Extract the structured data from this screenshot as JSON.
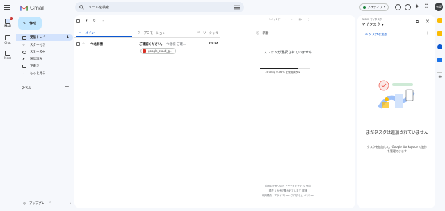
{
  "app": {
    "name": "Gmail"
  },
  "rail": {
    "mail_label": "Mail",
    "mail_badge": "1",
    "chat_label": "Chat",
    "meet_label": "Meet"
  },
  "search": {
    "placeholder": "メールを検索"
  },
  "header": {
    "status_label": "アクティブ",
    "avatar": "有坂"
  },
  "compose": {
    "label": "作成"
  },
  "nav": [
    {
      "label": "受信トレイ",
      "count": "1"
    },
    {
      "label": "スター付き"
    },
    {
      "label": "スヌーズ中"
    },
    {
      "label": "送信済み"
    },
    {
      "label": "下書き"
    },
    {
      "label": "もっと見る"
    }
  ],
  "labels": {
    "title": "ラベル"
  },
  "upgrade": {
    "label": "アップグレード"
  },
  "toolbar": {
    "pager": "1–1 / 1 行"
  },
  "tabs": [
    {
      "label": "メイン"
    },
    {
      "label": "プロモーション"
    },
    {
      "label": "ソーシャル"
    },
    {
      "label": "新着"
    }
  ],
  "email": {
    "sender": "今北有樹",
    "subject": "ご確認ください。",
    "snippet": " - 今北様 ご確...",
    "time": "20:24",
    "attachment": "google_cloud_g..."
  },
  "reading": {
    "empty": "スレッドが選択されていません",
    "storage": "15 GB 中 0.06 % を使用済み",
    "storage_fraction": 0.75,
    "footer1": "前回のアカウント アクティビティ: 0 分前",
    "footer2": "現在 1 か所で開かれています  詳細",
    "footer3": "利用規約 · プライバシー · プログラム ポリシー"
  },
  "tasks": {
    "subtitle": "TASKS マイタスク",
    "title": "マイタスク ▾",
    "add": "タスクを追加",
    "empty_title": "まだタスクは追加されていません",
    "empty_hint": "タスクを追加して、Google Workspace で進捗を管理できます"
  },
  "colors": {
    "accent": "#0b57d0",
    "compose_bg": "#c2e7ff",
    "active_nav": "#d3e3fd"
  }
}
